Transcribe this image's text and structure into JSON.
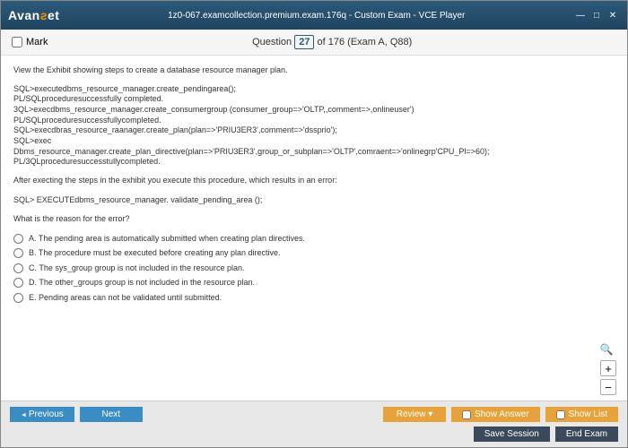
{
  "titlebar": {
    "logo_pre": "Avan",
    "logo_o": "ƨ",
    "logo_post": "et",
    "title": "1z0-067.examcollection.premium.exam.176q - Custom Exam - VCE Player"
  },
  "header": {
    "mark_label": "Mark",
    "question_word": "Question",
    "current_num": "27",
    "total_text": " of 176 (Exam A, Q88)"
  },
  "content": {
    "intro": "View the Exhibit showing steps to create a database resource manager plan.",
    "code1": "SQL>executedbms_resource_manager.create_pendingarea();",
    "code2": "PL/SQLproceduresuccessfully completed.",
    "code3": "3QL>execdbms_resource_manager.create_consumergroup (consumer_group=>'OLTP,,comment=>,onlineuser')",
    "code4": "PL/SQLproceduresuccessfullycompleted.",
    "code5": "SQL>execdbras_resource_raanager.create_plan(plan=>'PRIU3ER3',comment=>'dssprio');",
    "code6": "SQL>exec",
    "code7": "Dbms_resource_manager.create_plan_directive(plan=>'PRIU3ER3',group_or_subplan=>'OLTP',comraent=>'onlinegrp'CPU_Pl=>60);",
    "code8": "PL/3QLproceduresuccesstullycompleted.",
    "after": "After execting the steps in the exhibit you execute this procedure, which results in an error:",
    "exec_line": "SQL> EXECUTEdbms_resource_manager. validate_pending_area ();",
    "question": "What is the reason for the error?",
    "options": [
      "A.  The pending area is automatically submitted when creating plan directives.",
      "B.  The procedure must be executed before creating any plan directive.",
      "C.  The sys_group group is not included in the resource plan.",
      "D.  The other_groups group is not included in the resource plan.",
      "E.  Pending areas can not be validated until submitted."
    ]
  },
  "buttons": {
    "previous": "Previous",
    "next": "Next",
    "review": "Review",
    "show_answer": "Show Answer",
    "show_list": "Show List",
    "save_session": "Save Session",
    "end_exam": "End Exam"
  }
}
